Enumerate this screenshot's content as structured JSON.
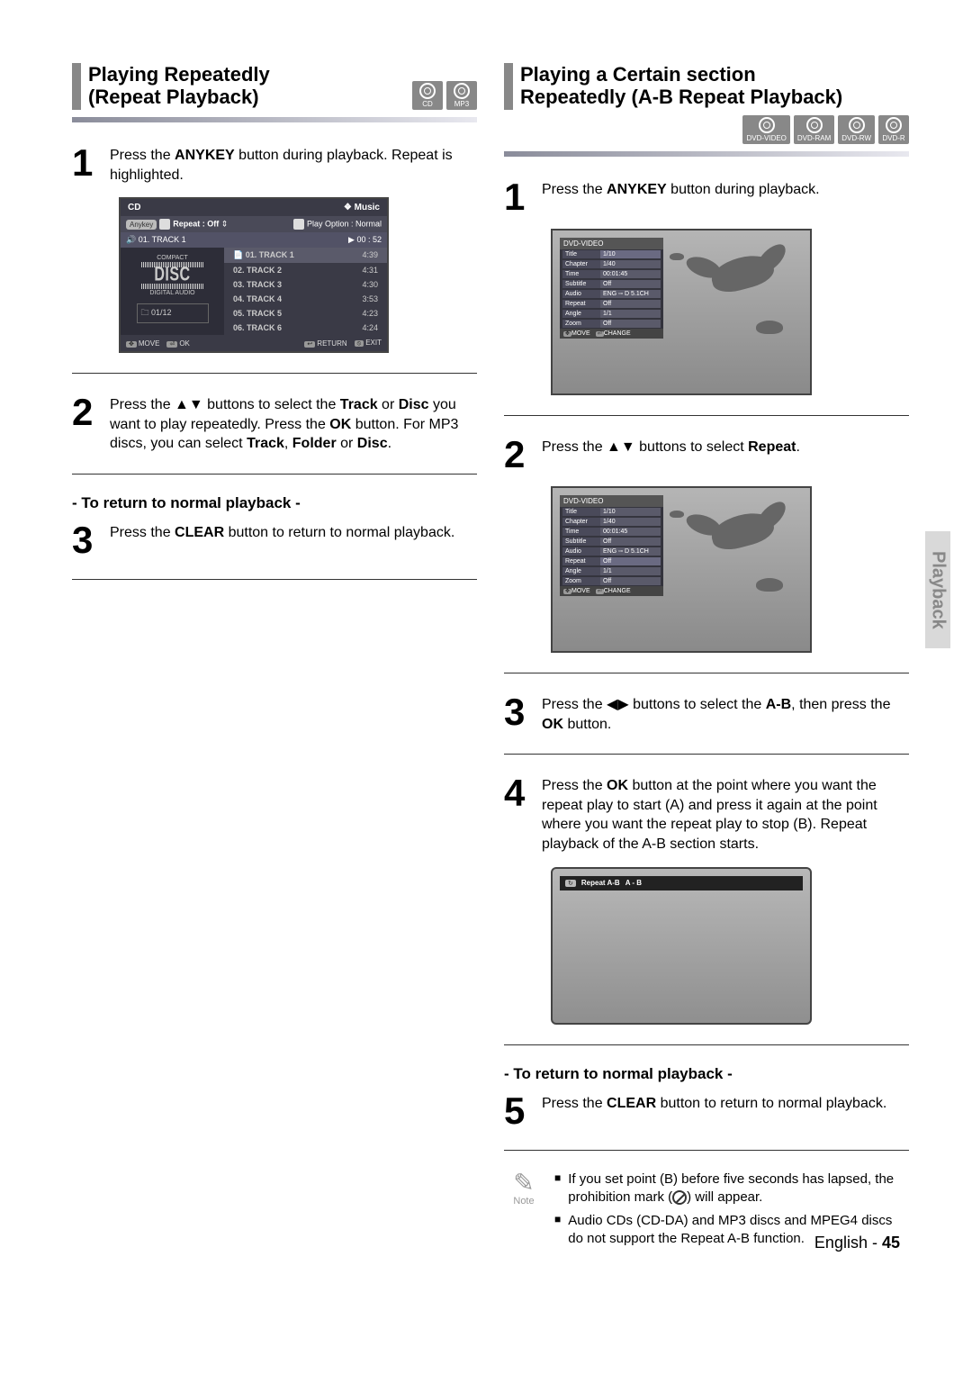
{
  "left": {
    "heading_line1": "Playing Repeatedly",
    "heading_line2": "(Repeat Playback)",
    "badges": [
      "CD",
      "MP3"
    ],
    "step1": {
      "num": "1",
      "pre": "Press the ",
      "bold1": "ANYKEY",
      "mid": " button during playback. Repeat is highlighted."
    },
    "step2": {
      "num": "2",
      "pre": "Press the ",
      "arrows": "▲▼",
      "mid1": " buttons to select the ",
      "bold1": "Track",
      "mid2": " or ",
      "bold2": "Disc",
      "mid3": " you want to play repeatedly. Press the ",
      "bold3": "OK",
      "mid4": " button. For MP3 discs, you can select ",
      "bold4": "Track",
      "mid5": ", ",
      "bold5": "Folder",
      "mid6": " or ",
      "bold6": "Disc",
      "end": "."
    },
    "return_heading": "- To return to normal playback -",
    "step3": {
      "num": "3",
      "pre": "Press the ",
      "bold1": "CLEAR",
      "end": " button to return to normal playback."
    },
    "osd": {
      "title_left": "CD",
      "title_right": "❖ Music",
      "anykey": "Anykey",
      "repeat_label": "Repeat : Off",
      "play_option": "Play Option : Normal",
      "now_playing": "01. TRACK 1",
      "now_time": "00 : 52",
      "compact": "COMPACT",
      "disc_text": "DISC",
      "digital_audio": "DIGITAL AUDIO",
      "file_count": "01/12",
      "tracks": [
        {
          "name": "01. TRACK 1",
          "time": "4:39"
        },
        {
          "name": "02. TRACK 2",
          "time": "4:31"
        },
        {
          "name": "03. TRACK 3",
          "time": "4:30"
        },
        {
          "name": "04. TRACK 4",
          "time": "3:53"
        },
        {
          "name": "05. TRACK 5",
          "time": "4:23"
        },
        {
          "name": "06. TRACK 6",
          "time": "4:24"
        }
      ],
      "footer": {
        "move": "MOVE",
        "ok": "OK",
        "return": "RETURN",
        "exit": "EXIT"
      }
    }
  },
  "right": {
    "heading_line1": "Playing a Certain section",
    "heading_line2": "Repeatedly (A-B Repeat Playback)",
    "badges": [
      "DVD-VIDEO",
      "DVD-RAM",
      "DVD-RW",
      "DVD-R"
    ],
    "step1": {
      "num": "1",
      "pre": "Press the ",
      "bold1": "ANYKEY",
      "end": " button during playback."
    },
    "step2": {
      "num": "2",
      "pre": "Press the ",
      "arrows": "▲▼",
      "mid": " buttons to select ",
      "bold1": "Repeat",
      "end": "."
    },
    "step3": {
      "num": "3",
      "pre": "Press the ",
      "arrows": "◀▶",
      "mid1": " buttons to select the ",
      "bold1": "A-B",
      "mid2": ", then press the ",
      "bold2": "OK",
      "end": " button."
    },
    "step4": {
      "num": "4",
      "pre": "Press the ",
      "bold1": "OK",
      "end": " button at the point where you want the repeat play to start (A) and press it again at the point where you want the repeat play to stop (B). Repeat playback of the A-B section starts."
    },
    "return_heading": "- To return to normal playback -",
    "step5": {
      "num": "5",
      "pre": "Press the ",
      "bold1": "CLEAR",
      "end": " button to return to normal playback."
    },
    "note_label": "Note",
    "note1_pre": "If you set point (B) before five seconds has lapsed, the prohibition mark (",
    "note1_post": ") will appear.",
    "note2": "Audio CDs (CD-DA) and MP3 discs and MPEG4 discs do not support the Repeat A-B function.",
    "osd_dvd": {
      "header": "DVD-VIDEO",
      "rows": [
        {
          "label": "Title",
          "val": "1/10"
        },
        {
          "label": "Chapter",
          "val": "1/40"
        },
        {
          "label": "Time",
          "val": "00:01:45"
        },
        {
          "label": "Subtitle",
          "val": "Off"
        },
        {
          "label": "Audio",
          "val": "ENG ▫▫ D  5.1CH"
        },
        {
          "label": "Repeat",
          "val": "Off"
        },
        {
          "label": "Angle",
          "val": "1/1"
        },
        {
          "label": "Zoom",
          "val": "Off"
        }
      ],
      "footer": {
        "move": "MOVE",
        "change": "CHANGE"
      }
    },
    "osd_ab": {
      "repeat_label": "Repeat  A-B",
      "value": "A - B"
    }
  },
  "side_tab": "Playback",
  "footer_lang": "English - ",
  "footer_page": "45"
}
